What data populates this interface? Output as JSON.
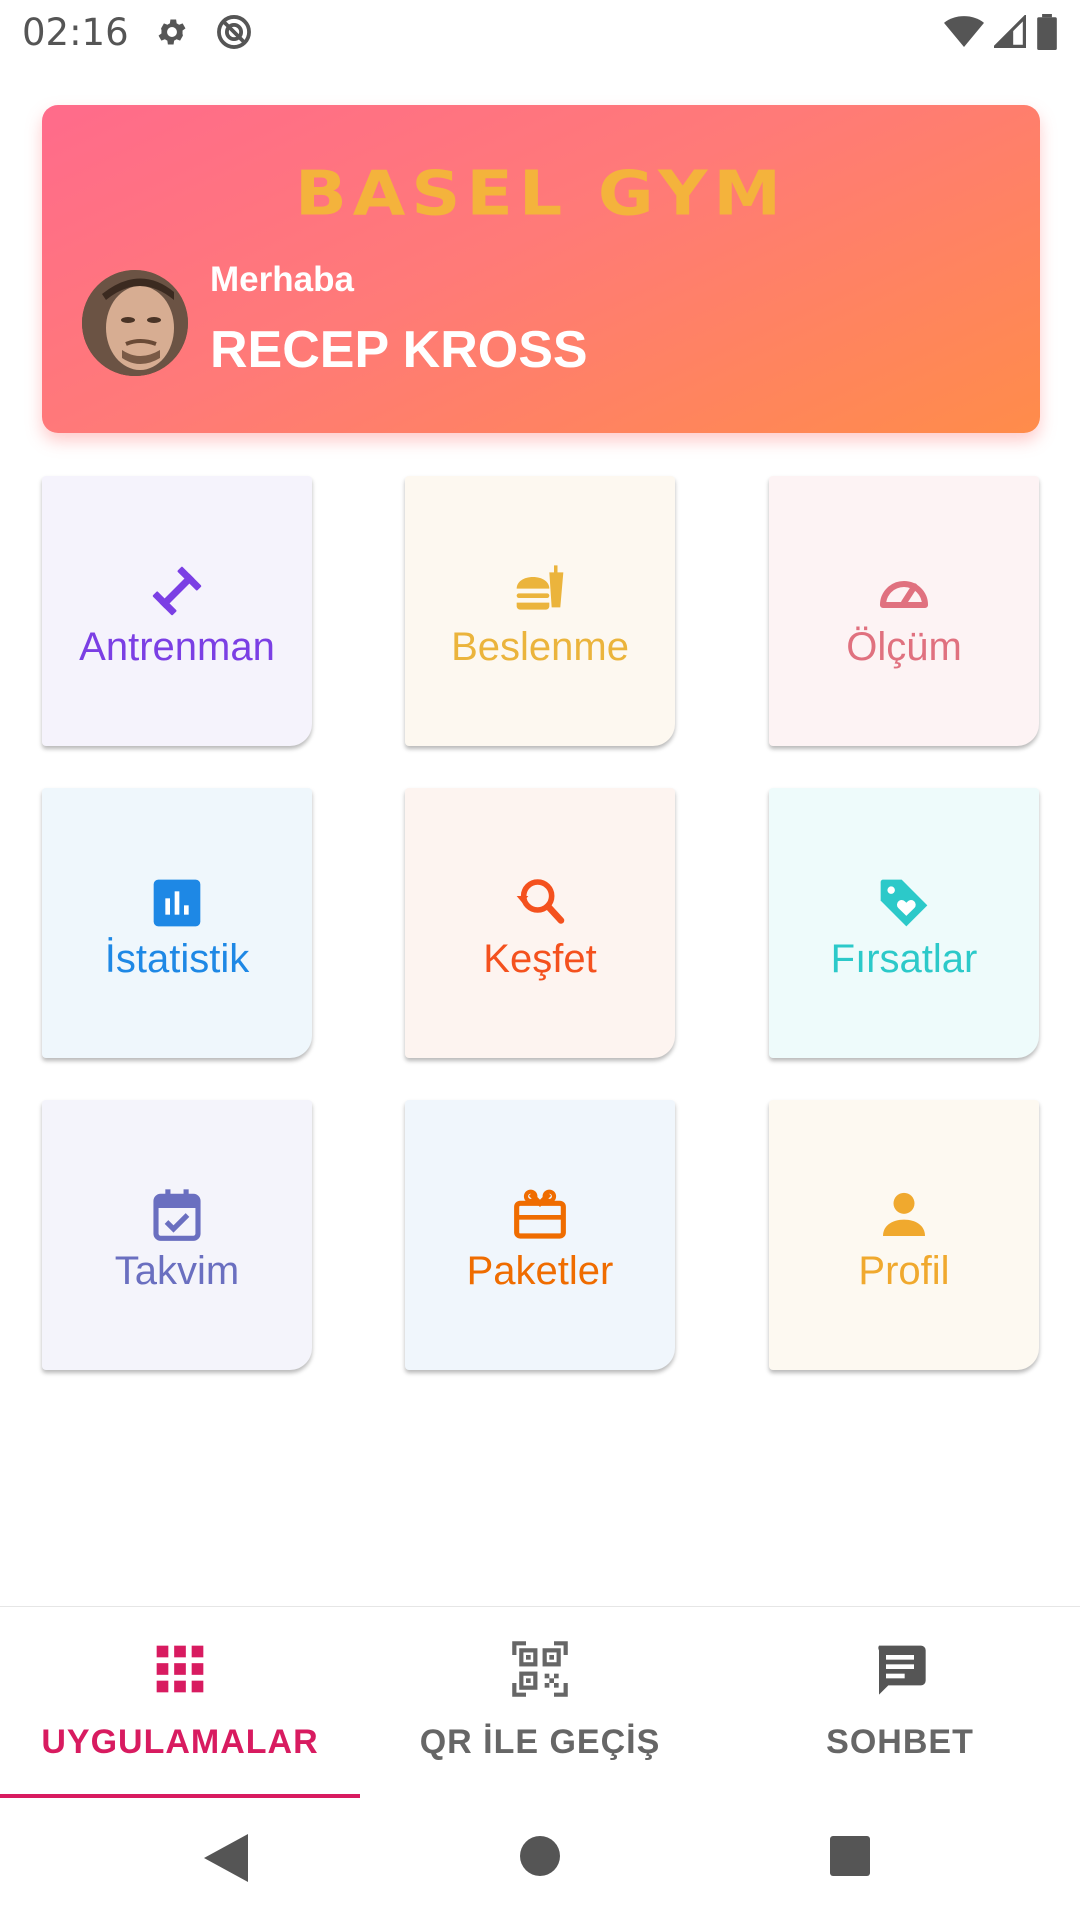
{
  "status_bar": {
    "time": "02:16"
  },
  "header": {
    "brand": "BASEL GYM",
    "greeting": "Merhaba",
    "user_name": "RECEP KROSS"
  },
  "tiles": [
    {
      "label": "Antrenman",
      "icon": "dumbbell-icon",
      "color": "#7b3fe4",
      "bg": "#f5f3fc"
    },
    {
      "label": "Beslenme",
      "icon": "fastfood-icon",
      "color": "#ebb43c",
      "bg": "#fdf8f0"
    },
    {
      "label": "Ölçüm",
      "icon": "speedometer-icon",
      "color": "#e0717f",
      "bg": "#fdf3f4"
    },
    {
      "label": "İstatistik",
      "icon": "bar-chart-icon",
      "color": "#1e88e5",
      "bg": "#eff7fc"
    },
    {
      "label": "Keşfet",
      "icon": "search-refresh-icon",
      "color": "#f4511e",
      "bg": "#fdf4f0"
    },
    {
      "label": "Fırsatlar",
      "icon": "tag-heart-icon",
      "color": "#2cc9c9",
      "bg": "#eefbfb"
    },
    {
      "label": "Takvim",
      "icon": "calendar-check-icon",
      "color": "#6a6fc0",
      "bg": "#f4f4fb"
    },
    {
      "label": "Paketler",
      "icon": "gift-box-icon",
      "color": "#ef6c00",
      "bg": "#f0f6fc"
    },
    {
      "label": "Profil",
      "icon": "person-icon",
      "color": "#f0a92e",
      "bg": "#fdf9f1"
    }
  ],
  "bottom_nav": {
    "active_color": "#d81b60",
    "inactive_color": "#666666",
    "tabs": [
      {
        "label": "UYGULAMALAR",
        "icon": "apps-grid-icon",
        "active": true
      },
      {
        "label": "QR İLE GEÇİŞ",
        "icon": "qr-code-icon",
        "active": false
      },
      {
        "label": "SOHBET",
        "icon": "chat-icon",
        "active": false
      }
    ]
  }
}
